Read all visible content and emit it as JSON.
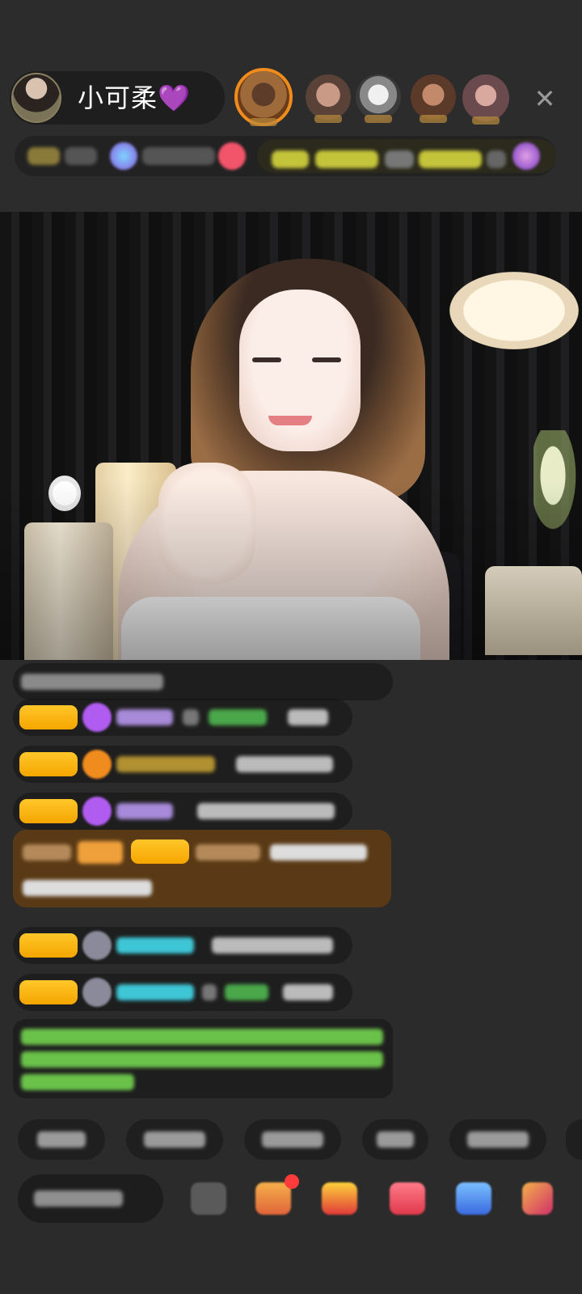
{
  "header": {
    "host_name": "小可柔💜",
    "close_label": "✕"
  },
  "viewers": {
    "avatars": [
      "viewer-avatar-1",
      "viewer-avatar-2",
      "viewer-avatar-3",
      "viewer-avatar-4",
      "viewer-avatar-5"
    ]
  },
  "stats_bar": {},
  "chat": {},
  "quick_replies": {},
  "toolbar": {
    "icons": [
      "more-icon",
      "gift-box-icon",
      "gift-icon",
      "heart-gift-icon",
      "game-icon",
      "menu-icon"
    ]
  },
  "colors": {
    "accent_orange": "#f08b1e",
    "badge_yellow": "#ffc72a",
    "gem_purple": "#b05cf0",
    "name_cyan": "#3ec6d6",
    "name_green": "#4aa84a",
    "system_green": "#6bc24a",
    "highlight_bg": "#5a3a16"
  }
}
